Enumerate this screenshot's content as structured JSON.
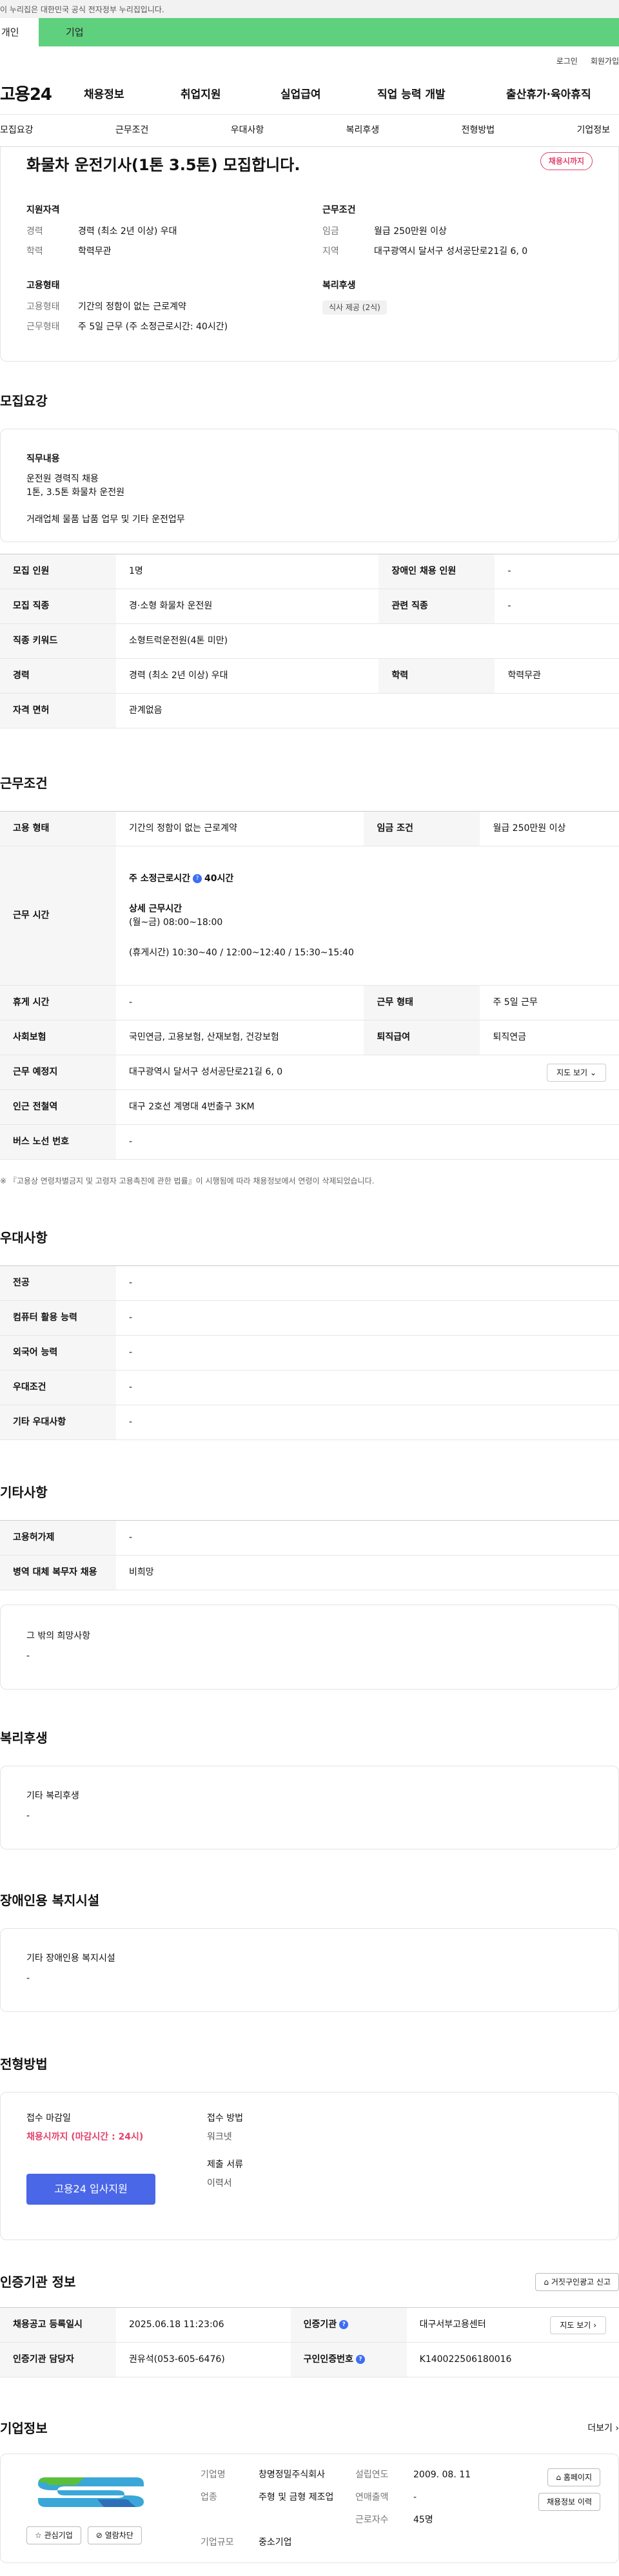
{
  "gov_notice": "이 누리집은 대한민국 공식 전자정부 누리집입니다.",
  "tabs": [
    "개인",
    "기업"
  ],
  "util_links": [
    "로그인",
    "회원가입"
  ],
  "logo": "고용24",
  "gnb": [
    "채용정보",
    "취업지원",
    "실업급여",
    "직업 능력 개발",
    "출산휴가·육아휴직"
  ],
  "subnav": [
    "모집요강",
    "근무조건",
    "우대사항",
    "복리후생",
    "전형방법",
    "기업정보"
  ],
  "summary": {
    "title": "화물차 운전기사(1톤 3.5톤) 모집합니다.",
    "status": "채용시까지",
    "qual_title": "지원자격",
    "career_k": "경력",
    "career_v": "경력 (최소 2년 이상) 우대",
    "edu_k": "학력",
    "edu_v": "학력무관",
    "cond_title": "근무조건",
    "wage_k": "임금",
    "wage_v": "월급 250만원 이상",
    "region_k": "지역",
    "region_v": "대구광역시 달서구 성서공단로21길 6, 0",
    "emp_title": "고용형태",
    "emptype_k": "고용형태",
    "emptype_v": "기간의 정함이 없는 근로계약",
    "workday_k": "근무형태",
    "workday_v": "주 5일 근무 (주 소정근로시간: 40시간)",
    "welfare_title": "복리후생",
    "welfare_chip": "식사 제공 (2식)"
  },
  "recruit": {
    "section_title": "모집요강",
    "duty_title": "직무내용",
    "duty_lines": [
      "운전원 경력직 채용",
      "1톤, 3.5톤 화물차 운전원",
      "",
      "거래업체 물품 납품 업무 및 기타 운전업무"
    ],
    "rows": [
      [
        "모집 인원",
        "1명",
        "장애인 채용 인원",
        "-"
      ],
      [
        "모집 직종",
        "경·소형 화물차 운전원",
        "관련 직종",
        "-"
      ],
      [
        "직종 키워드",
        "소형트럭운전원(4톤 미만)",
        "",
        ""
      ],
      [
        "경력",
        "경력 (최소 2년 이상) 우대",
        "학력",
        "학력무관"
      ],
      [
        "자격 면허",
        "관계없음",
        "",
        ""
      ]
    ]
  },
  "work": {
    "section_title": "근무조건",
    "emp_k": "고용 형태",
    "emp_v": "기간의 정함이 없는 근로계약",
    "wage_k": "임금 조건",
    "wage_v": "월급 250만원 이상",
    "time_k": "근무 시간",
    "time_main": "주 소정근로시간",
    "time_hours": "40시간",
    "time_detail_title": "상세 근무시간",
    "time_detail": "(월~금) 08:00~18:00",
    "time_break": "(휴게시간) 10:30~40 / 12:00~12:40 / 15:30~15:40",
    "break_k": "휴게 시간",
    "break_v": "-",
    "form_k": "근무 형태",
    "form_v": "주 5일 근무",
    "ins_k": "사회보험",
    "ins_v": "국민연금, 고용보험, 산재보험, 건강보험",
    "ret_k": "퇴직급여",
    "ret_v": "퇴직연금",
    "place_k": "근무 예정지",
    "place_v": "대구광역시 달서구 성서공단로21길 6, 0",
    "map_btn": "지도 보기",
    "subway_k": "인근 전철역",
    "subway_v": "대구 2호선 계명대 4번출구 3KM",
    "bus_k": "버스 노선 번호",
    "bus_v": "-",
    "note": "※ 『고용상 연령차별금지 및 고령자 고용촉진에 관한 법률』이 시행됨에 따라 채용정보에서 연령이 삭제되었습니다."
  },
  "pref": {
    "section_title": "우대사항",
    "rows": [
      [
        "전공",
        "-"
      ],
      [
        "컴퓨터 활용 능력",
        "-"
      ],
      [
        "외국어 능력",
        "-"
      ],
      [
        "우대조건",
        "-"
      ],
      [
        "기타 우대사항",
        "-"
      ]
    ]
  },
  "etc": {
    "section_title": "기타사항",
    "rows": [
      [
        "고용허가제",
        "-"
      ],
      [
        "병역 대체 복무자 채용",
        "비희망"
      ]
    ],
    "wish_title": "그 밖의 희망사항",
    "wish_v": "-"
  },
  "welfare": {
    "section_title": "복리후생",
    "box_title": "기타 복리후생",
    "box_v": "-"
  },
  "disabled": {
    "section_title": "장애인용 복지시설",
    "box_title": "기타 장애인용 복지시설",
    "box_v": "-"
  },
  "selection": {
    "section_title": "전형방법",
    "deadline_k": "접수 마감일",
    "deadline_v": "채용시까지 (마감시간 : 24시)",
    "apply_btn": "고용24 입사지원",
    "method_k": "접수 방법",
    "method_v": "워크넷",
    "docs_k": "제출 서류",
    "docs_v": "이력서"
  },
  "cert": {
    "section_title": "인증기관 정보",
    "report_btn": "거짓구인광고 신고",
    "reg_k": "채용공고 등록일시",
    "reg_v": "2025.06.18 11:23:06",
    "org_k": "인증기관",
    "org_v": "대구서부고용센터",
    "map_btn": "지도 보기",
    "mgr_k": "인증기관 담당자",
    "mgr_v": "권유석(053-605-6476)",
    "no_k": "구인인증번호",
    "no_v": "K140022506180016"
  },
  "company": {
    "section_title": "기업정보",
    "more": "더보기",
    "fav_btn": "관심기업",
    "block_btn": "열람차단",
    "name_k": "기업명",
    "name_v": "창명정밀주식회사",
    "founded_k": "설립연도",
    "founded_v": "2009. 08. 11",
    "biz_k": "업종",
    "biz_v": "주형 및 금형 제조업",
    "sales_k": "연매출액",
    "sales_v": "-",
    "emp_k": "근로자수",
    "emp_v": "45명",
    "size_k": "기업규모",
    "size_v": "중소기업",
    "home_btn": "홈페이지",
    "history_btn": "채용정보 이력"
  },
  "colors": {
    "accent_green": "#5fd07e",
    "accent_blue": "#4a67e8",
    "status_red": "#e3426d"
  }
}
